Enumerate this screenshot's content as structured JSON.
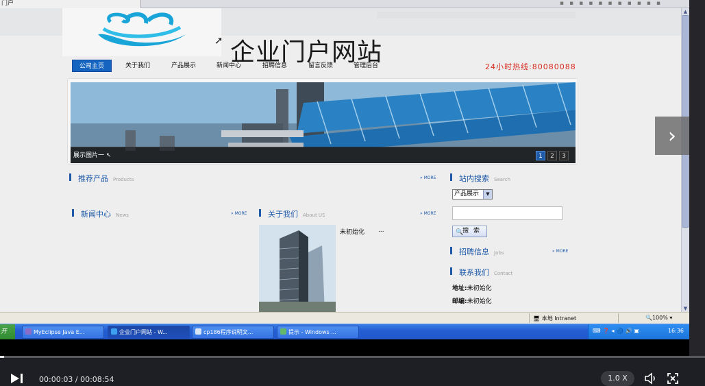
{
  "browser": {
    "tab_title": "门户"
  },
  "site": {
    "title": "企业门户网站",
    "nav": [
      "公司主页",
      "关于我们",
      "产品展示",
      "新闻中心",
      "招聘信息",
      "留言反馈",
      "管理后台"
    ],
    "hotline": "24小时热线:80080088"
  },
  "banner": {
    "caption": "展示图片一",
    "pages": [
      "1",
      "2",
      "3"
    ],
    "active_page": "1"
  },
  "sections": {
    "products": {
      "cn": "推荐产品",
      "en": "Products",
      "more": "» MORE"
    },
    "search": {
      "cn": "站内搜索",
      "en": "Search"
    },
    "news": {
      "cn": "新闻中心",
      "en": "News",
      "more": "» MORE"
    },
    "about": {
      "cn": "关于我们",
      "en": "About US",
      "more": "» MORE",
      "text": "未初始化",
      "dots": "..."
    },
    "jobs": {
      "cn": "招聘信息",
      "en": "Jobs",
      "more": "» MORE"
    },
    "contact": {
      "cn": "联系我们",
      "en": "Contact",
      "address_label": "地址:",
      "address_value": "未初始化",
      "zip_label": "邮编:",
      "zip_value": "未初始化"
    }
  },
  "search_form": {
    "select_value": "产品展示",
    "input_value": "",
    "button": "搜 索"
  },
  "statusbar": {
    "zone": "本地 Intranet",
    "zoom": "100%"
  },
  "taskbar": {
    "start": "开",
    "tasks": [
      "MyEclipse Java E...",
      "企业门户网站 - W...",
      "cp186程序说明文...",
      "提示 - Windows ..."
    ],
    "clock": "16:36"
  },
  "player": {
    "time": "00:00:03 / 00:08:54",
    "progress": 0.0056,
    "speed": "1.0 X"
  },
  "colors": {
    "accent": "#1e5aa8",
    "hotline": "#d62b1f",
    "taskbar": "#245ed3"
  }
}
